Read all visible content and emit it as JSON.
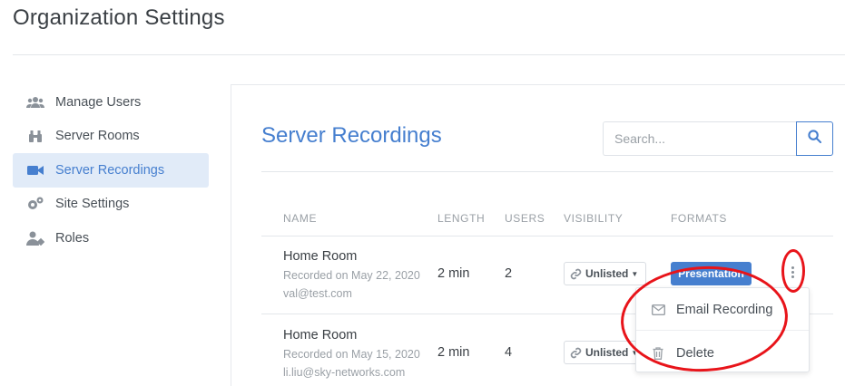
{
  "page": {
    "title": "Organization Settings"
  },
  "sidebar": {
    "items": [
      {
        "label": "Manage Users",
        "icon": "users-icon",
        "active": false
      },
      {
        "label": "Server Rooms",
        "icon": "binoculars-icon",
        "active": false
      },
      {
        "label": "Server Recordings",
        "icon": "video-camera-icon",
        "active": true
      },
      {
        "label": "Site Settings",
        "icon": "gears-icon",
        "active": false
      },
      {
        "label": "Roles",
        "icon": "user-tag-icon",
        "active": false
      }
    ]
  },
  "main": {
    "title": "Server Recordings",
    "search": {
      "placeholder": "Search...",
      "value": ""
    },
    "table": {
      "headers": [
        "NAME",
        "LENGTH",
        "USERS",
        "VISIBILITY",
        "FORMATS"
      ],
      "rows": [
        {
          "name": "Home Room",
          "recorded": "Recorded on May 22, 2020",
          "owner": "val@test.com",
          "length": "2 min",
          "users": "2",
          "visibility": "Unlisted",
          "format": "Presentation"
        },
        {
          "name": "Home Room",
          "recorded": "Recorded on May 15, 2020",
          "owner": "li.liu@sky-networks.com",
          "length": "2 min",
          "users": "4",
          "visibility": "Unlisted"
        }
      ]
    },
    "menu": {
      "items": [
        {
          "label": "Email Recording",
          "icon": "envelope-icon"
        },
        {
          "label": "Delete",
          "icon": "trash-icon"
        }
      ]
    }
  },
  "colors": {
    "accent": "#467fcf",
    "active_bg": "#e1ebf8",
    "annotation": "#e8141a"
  }
}
